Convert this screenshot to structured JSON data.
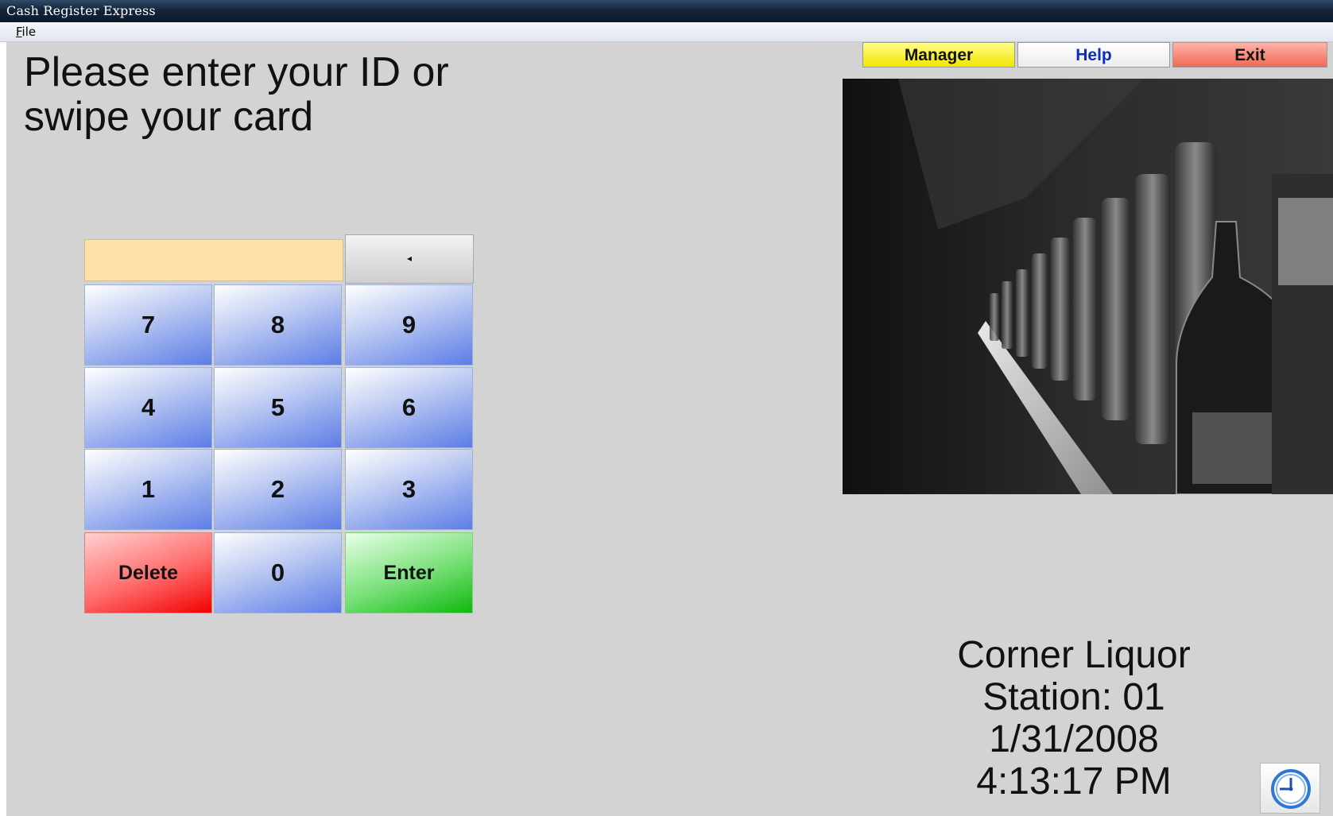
{
  "window": {
    "title": "Cash Register Express"
  },
  "menu": {
    "file_rest": "ile",
    "file_accel": "F"
  },
  "prompt": {
    "line1": "Please enter your ID or",
    "line2": "swipe your card"
  },
  "top_buttons": {
    "manager": "Manager",
    "help": "Help",
    "exit": "Exit"
  },
  "id_input": {
    "value": ""
  },
  "keypad": {
    "backspace": "◂",
    "keys": [
      "7",
      "8",
      "9",
      "4",
      "5",
      "6",
      "1",
      "2",
      "3"
    ],
    "delete": "Delete",
    "zero": "0",
    "enter": "Enter"
  },
  "info": {
    "store": "Corner Liquor",
    "station": "Station: 01",
    "date": "1/31/2008",
    "time": "4:13:17 PM"
  },
  "icons": {
    "clock": "clock-icon",
    "backspace": "left-triangle-icon"
  },
  "colors": {
    "manager": "#f2e600",
    "help_text": "#0a2cc4",
    "exit": "#ef6a55",
    "id_field": "#ffe0a8",
    "digit_key": "#5c7de6",
    "delete_key": "#f20000",
    "enter_key": "#10b810",
    "background": "#d3d3d3"
  }
}
